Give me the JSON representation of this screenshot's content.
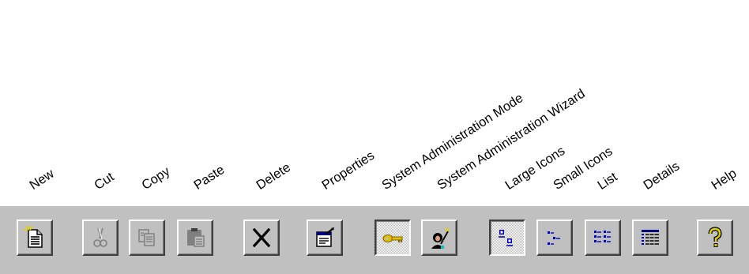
{
  "toolbar": {
    "buttons": [
      {
        "id": "new",
        "label": "New",
        "icon": "new-document-icon",
        "enabled": true,
        "pressed": false
      },
      {
        "id": "cut",
        "label": "Cut",
        "icon": "scissors-icon",
        "enabled": false,
        "pressed": false
      },
      {
        "id": "copy",
        "label": "Copy",
        "icon": "copy-icon",
        "enabled": false,
        "pressed": false
      },
      {
        "id": "paste",
        "label": "Paste",
        "icon": "paste-icon",
        "enabled": false,
        "pressed": false
      },
      {
        "id": "delete",
        "label": "Delete",
        "icon": "delete-x-icon",
        "enabled": true,
        "pressed": false
      },
      {
        "id": "properties",
        "label": "Properties",
        "icon": "properties-icon",
        "enabled": true,
        "pressed": false
      },
      {
        "id": "sysadmin-mode",
        "label": "System Administration Mode",
        "icon": "key-icon",
        "enabled": true,
        "pressed": true
      },
      {
        "id": "sysadmin-wizard",
        "label": "System Administration Wizard",
        "icon": "wizard-icon",
        "enabled": true,
        "pressed": false
      },
      {
        "id": "large-icons",
        "label": "Large Icons",
        "icon": "large-icons-view-icon",
        "enabled": true,
        "pressed": true
      },
      {
        "id": "small-icons",
        "label": "Small Icons",
        "icon": "small-icons-view-icon",
        "enabled": true,
        "pressed": false
      },
      {
        "id": "list",
        "label": "List",
        "icon": "list-view-icon",
        "enabled": true,
        "pressed": false
      },
      {
        "id": "details",
        "label": "Details",
        "icon": "details-view-icon",
        "enabled": true,
        "pressed": false
      },
      {
        "id": "help",
        "label": "Help",
        "icon": "help-question-icon",
        "enabled": true,
        "pressed": false
      }
    ]
  },
  "colors": {
    "face": "#c0c0c0",
    "highlight": "#ffffff",
    "shadow": "#808080",
    "dark_shadow": "#404040",
    "accent_blue": "#0000c0",
    "key_yellow": "#e0c000"
  }
}
